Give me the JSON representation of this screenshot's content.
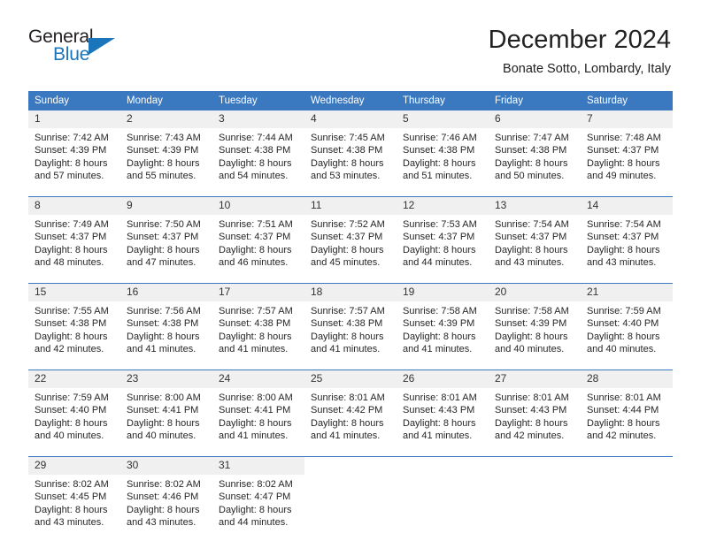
{
  "brand": {
    "word_top": "General",
    "word_bottom": "Blue",
    "triangle_icon": "brand-triangle-icon",
    "accent_color": "#1b75bb",
    "dark_color": "#231f20"
  },
  "header": {
    "title": "December 2024",
    "subtitle": "Bonate Sotto, Lombardy, Italy"
  },
  "theme": {
    "header_blue": "#3a78bf",
    "daynum_band": "#f0f0f0",
    "text": "#262626"
  },
  "calendar": {
    "weekday_headers": [
      "Sunday",
      "Monday",
      "Tuesday",
      "Wednesday",
      "Thursday",
      "Friday",
      "Saturday"
    ],
    "weeks": [
      [
        {
          "day": "1",
          "sunrise": "Sunrise: 7:42 AM",
          "sunset": "Sunset: 4:39 PM",
          "daylight_l1": "Daylight: 8 hours",
          "daylight_l2": "and 57 minutes."
        },
        {
          "day": "2",
          "sunrise": "Sunrise: 7:43 AM",
          "sunset": "Sunset: 4:39 PM",
          "daylight_l1": "Daylight: 8 hours",
          "daylight_l2": "and 55 minutes."
        },
        {
          "day": "3",
          "sunrise": "Sunrise: 7:44 AM",
          "sunset": "Sunset: 4:38 PM",
          "daylight_l1": "Daylight: 8 hours",
          "daylight_l2": "and 54 minutes."
        },
        {
          "day": "4",
          "sunrise": "Sunrise: 7:45 AM",
          "sunset": "Sunset: 4:38 PM",
          "daylight_l1": "Daylight: 8 hours",
          "daylight_l2": "and 53 minutes."
        },
        {
          "day": "5",
          "sunrise": "Sunrise: 7:46 AM",
          "sunset": "Sunset: 4:38 PM",
          "daylight_l1": "Daylight: 8 hours",
          "daylight_l2": "and 51 minutes."
        },
        {
          "day": "6",
          "sunrise": "Sunrise: 7:47 AM",
          "sunset": "Sunset: 4:38 PM",
          "daylight_l1": "Daylight: 8 hours",
          "daylight_l2": "and 50 minutes."
        },
        {
          "day": "7",
          "sunrise": "Sunrise: 7:48 AM",
          "sunset": "Sunset: 4:37 PM",
          "daylight_l1": "Daylight: 8 hours",
          "daylight_l2": "and 49 minutes."
        }
      ],
      [
        {
          "day": "8",
          "sunrise": "Sunrise: 7:49 AM",
          "sunset": "Sunset: 4:37 PM",
          "daylight_l1": "Daylight: 8 hours",
          "daylight_l2": "and 48 minutes."
        },
        {
          "day": "9",
          "sunrise": "Sunrise: 7:50 AM",
          "sunset": "Sunset: 4:37 PM",
          "daylight_l1": "Daylight: 8 hours",
          "daylight_l2": "and 47 minutes."
        },
        {
          "day": "10",
          "sunrise": "Sunrise: 7:51 AM",
          "sunset": "Sunset: 4:37 PM",
          "daylight_l1": "Daylight: 8 hours",
          "daylight_l2": "and 46 minutes."
        },
        {
          "day": "11",
          "sunrise": "Sunrise: 7:52 AM",
          "sunset": "Sunset: 4:37 PM",
          "daylight_l1": "Daylight: 8 hours",
          "daylight_l2": "and 45 minutes."
        },
        {
          "day": "12",
          "sunrise": "Sunrise: 7:53 AM",
          "sunset": "Sunset: 4:37 PM",
          "daylight_l1": "Daylight: 8 hours",
          "daylight_l2": "and 44 minutes."
        },
        {
          "day": "13",
          "sunrise": "Sunrise: 7:54 AM",
          "sunset": "Sunset: 4:37 PM",
          "daylight_l1": "Daylight: 8 hours",
          "daylight_l2": "and 43 minutes."
        },
        {
          "day": "14",
          "sunrise": "Sunrise: 7:54 AM",
          "sunset": "Sunset: 4:37 PM",
          "daylight_l1": "Daylight: 8 hours",
          "daylight_l2": "and 43 minutes."
        }
      ],
      [
        {
          "day": "15",
          "sunrise": "Sunrise: 7:55 AM",
          "sunset": "Sunset: 4:38 PM",
          "daylight_l1": "Daylight: 8 hours",
          "daylight_l2": "and 42 minutes."
        },
        {
          "day": "16",
          "sunrise": "Sunrise: 7:56 AM",
          "sunset": "Sunset: 4:38 PM",
          "daylight_l1": "Daylight: 8 hours",
          "daylight_l2": "and 41 minutes."
        },
        {
          "day": "17",
          "sunrise": "Sunrise: 7:57 AM",
          "sunset": "Sunset: 4:38 PM",
          "daylight_l1": "Daylight: 8 hours",
          "daylight_l2": "and 41 minutes."
        },
        {
          "day": "18",
          "sunrise": "Sunrise: 7:57 AM",
          "sunset": "Sunset: 4:38 PM",
          "daylight_l1": "Daylight: 8 hours",
          "daylight_l2": "and 41 minutes."
        },
        {
          "day": "19",
          "sunrise": "Sunrise: 7:58 AM",
          "sunset": "Sunset: 4:39 PM",
          "daylight_l1": "Daylight: 8 hours",
          "daylight_l2": "and 41 minutes."
        },
        {
          "day": "20",
          "sunrise": "Sunrise: 7:58 AM",
          "sunset": "Sunset: 4:39 PM",
          "daylight_l1": "Daylight: 8 hours",
          "daylight_l2": "and 40 minutes."
        },
        {
          "day": "21",
          "sunrise": "Sunrise: 7:59 AM",
          "sunset": "Sunset: 4:40 PM",
          "daylight_l1": "Daylight: 8 hours",
          "daylight_l2": "and 40 minutes."
        }
      ],
      [
        {
          "day": "22",
          "sunrise": "Sunrise: 7:59 AM",
          "sunset": "Sunset: 4:40 PM",
          "daylight_l1": "Daylight: 8 hours",
          "daylight_l2": "and 40 minutes."
        },
        {
          "day": "23",
          "sunrise": "Sunrise: 8:00 AM",
          "sunset": "Sunset: 4:41 PM",
          "daylight_l1": "Daylight: 8 hours",
          "daylight_l2": "and 40 minutes."
        },
        {
          "day": "24",
          "sunrise": "Sunrise: 8:00 AM",
          "sunset": "Sunset: 4:41 PM",
          "daylight_l1": "Daylight: 8 hours",
          "daylight_l2": "and 41 minutes."
        },
        {
          "day": "25",
          "sunrise": "Sunrise: 8:01 AM",
          "sunset": "Sunset: 4:42 PM",
          "daylight_l1": "Daylight: 8 hours",
          "daylight_l2": "and 41 minutes."
        },
        {
          "day": "26",
          "sunrise": "Sunrise: 8:01 AM",
          "sunset": "Sunset: 4:43 PM",
          "daylight_l1": "Daylight: 8 hours",
          "daylight_l2": "and 41 minutes."
        },
        {
          "day": "27",
          "sunrise": "Sunrise: 8:01 AM",
          "sunset": "Sunset: 4:43 PM",
          "daylight_l1": "Daylight: 8 hours",
          "daylight_l2": "and 42 minutes."
        },
        {
          "day": "28",
          "sunrise": "Sunrise: 8:01 AM",
          "sunset": "Sunset: 4:44 PM",
          "daylight_l1": "Daylight: 8 hours",
          "daylight_l2": "and 42 minutes."
        }
      ],
      [
        {
          "day": "29",
          "sunrise": "Sunrise: 8:02 AM",
          "sunset": "Sunset: 4:45 PM",
          "daylight_l1": "Daylight: 8 hours",
          "daylight_l2": "and 43 minutes."
        },
        {
          "day": "30",
          "sunrise": "Sunrise: 8:02 AM",
          "sunset": "Sunset: 4:46 PM",
          "daylight_l1": "Daylight: 8 hours",
          "daylight_l2": "and 43 minutes."
        },
        {
          "day": "31",
          "sunrise": "Sunrise: 8:02 AM",
          "sunset": "Sunset: 4:47 PM",
          "daylight_l1": "Daylight: 8 hours",
          "daylight_l2": "and 44 minutes."
        },
        {
          "day": "",
          "sunrise": "",
          "sunset": "",
          "daylight_l1": "",
          "daylight_l2": ""
        },
        {
          "day": "",
          "sunrise": "",
          "sunset": "",
          "daylight_l1": "",
          "daylight_l2": ""
        },
        {
          "day": "",
          "sunrise": "",
          "sunset": "",
          "daylight_l1": "",
          "daylight_l2": ""
        },
        {
          "day": "",
          "sunrise": "",
          "sunset": "",
          "daylight_l1": "",
          "daylight_l2": ""
        }
      ]
    ]
  }
}
